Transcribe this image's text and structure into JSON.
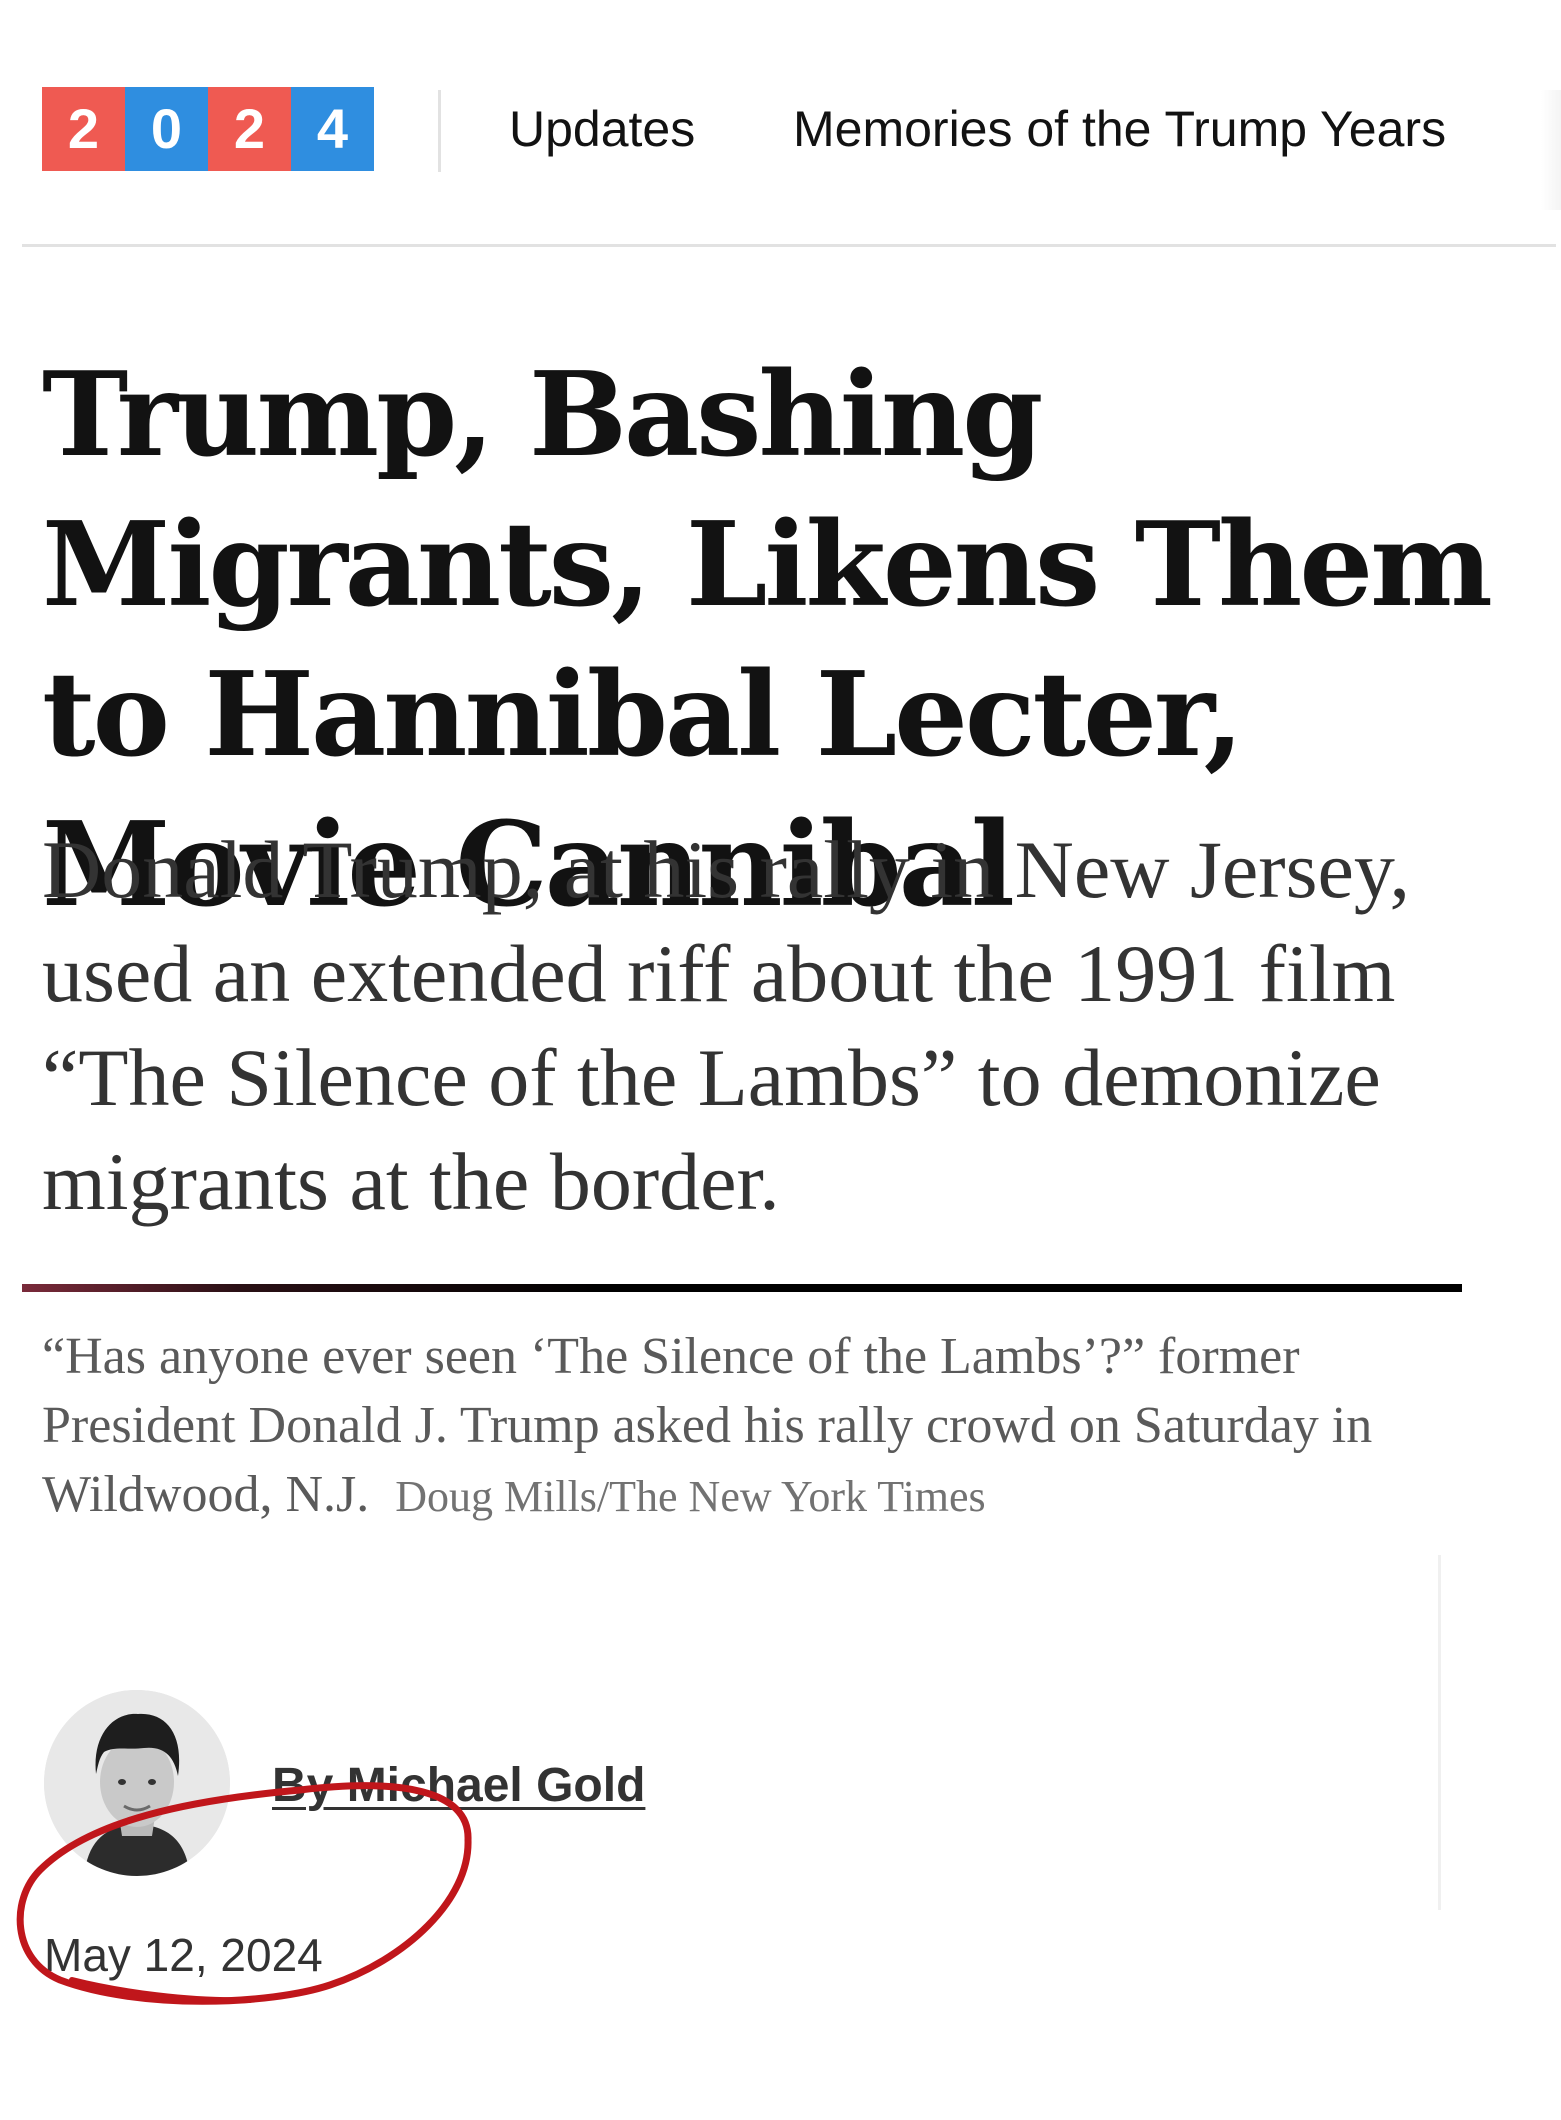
{
  "nav": {
    "logo_digits": [
      "2",
      "0",
      "2",
      "4"
    ],
    "links": [
      "Updates",
      "Memories of the Trump Years"
    ]
  },
  "colors": {
    "logo_red": "#ef5a52",
    "logo_blue": "#2f8ee0",
    "annotation_red": "#c0161b"
  },
  "article": {
    "headline": "Trump, Bashing Migrants, Likens Them to Hannibal Lecter, Movie Cannibal",
    "summary": "Donald Trump, at his rally in New Jersey, used an extended riff about the 1991 film “The Silence of the Lambs” to demonize migrants at the border.",
    "caption": "“Has anyone ever seen ‘The Silence of the Lambs’?” former President Donald J. Trump asked his rally crowd on Saturday in Wildwood, N.J.",
    "credit": "Doug Mills/The New York Times",
    "byline": "By Michael Gold",
    "date": "May 12, 2024"
  },
  "annotation": {
    "shape": "hand-drawn red circle around date"
  }
}
